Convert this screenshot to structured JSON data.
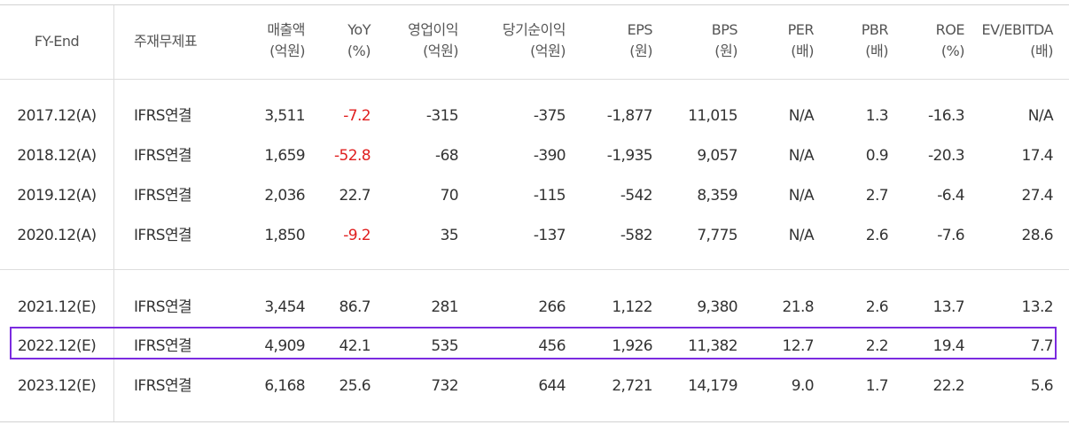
{
  "headers": [
    {
      "line1": "FY-End",
      "line2": ""
    },
    {
      "line1": "주재무제표",
      "line2": ""
    },
    {
      "line1": "매출액",
      "line2": "(억원)"
    },
    {
      "line1": "YoY",
      "line2": "(%)"
    },
    {
      "line1": "영업이익",
      "line2": "(억원)"
    },
    {
      "line1": "당기순이익",
      "line2": "(억원)"
    },
    {
      "line1": "EPS",
      "line2": "(원)"
    },
    {
      "line1": "BPS",
      "line2": "(원)"
    },
    {
      "line1": "PER",
      "line2": "(배)"
    },
    {
      "line1": "PBR",
      "line2": "(배)"
    },
    {
      "line1": "ROE",
      "line2": "(%)"
    },
    {
      "line1": "EV/EBITDA",
      "line2": "(배)"
    }
  ],
  "rows": [
    {
      "cells": [
        "2017.12(A)",
        "IFRS연결",
        "3,511",
        "-7.2",
        "-315",
        "-375",
        "-1,877",
        "11,015",
        "N/A",
        "1.3",
        "-16.3",
        "N/A"
      ],
      "yoy_negative": true
    },
    {
      "cells": [
        "2018.12(A)",
        "IFRS연결",
        "1,659",
        "-52.8",
        "-68",
        "-390",
        "-1,935",
        "9,057",
        "N/A",
        "0.9",
        "-20.3",
        "17.4"
      ],
      "yoy_negative": true
    },
    {
      "cells": [
        "2019.12(A)",
        "IFRS연결",
        "2,036",
        "22.7",
        "70",
        "-115",
        "-542",
        "8,359",
        "N/A",
        "2.7",
        "-6.4",
        "27.4"
      ],
      "yoy_negative": false
    },
    {
      "cells": [
        "2020.12(A)",
        "IFRS연결",
        "1,850",
        "-9.2",
        "35",
        "-137",
        "-582",
        "7,775",
        "N/A",
        "2.6",
        "-7.6",
        "28.6"
      ],
      "yoy_negative": true
    },
    {
      "cells": [
        "2021.12(E)",
        "IFRS연결",
        "3,454",
        "86.7",
        "281",
        "266",
        "1,122",
        "9,380",
        "21.8",
        "2.6",
        "13.7",
        "13.2"
      ],
      "yoy_negative": false
    },
    {
      "cells": [
        "2022.12(E)",
        "IFRS연결",
        "4,909",
        "42.1",
        "535",
        "456",
        "1,926",
        "11,382",
        "12.7",
        "2.2",
        "19.4",
        "7.7"
      ],
      "yoy_negative": false,
      "highlighted": true
    },
    {
      "cells": [
        "2023.12(E)",
        "IFRS연결",
        "6,168",
        "25.6",
        "732",
        "644",
        "2,721",
        "14,179",
        "9.0",
        "1.7",
        "22.2",
        "5.6"
      ],
      "yoy_negative": false
    }
  ],
  "colors": {
    "negative": "#e02020",
    "highlight_border": "#7b2be0"
  }
}
